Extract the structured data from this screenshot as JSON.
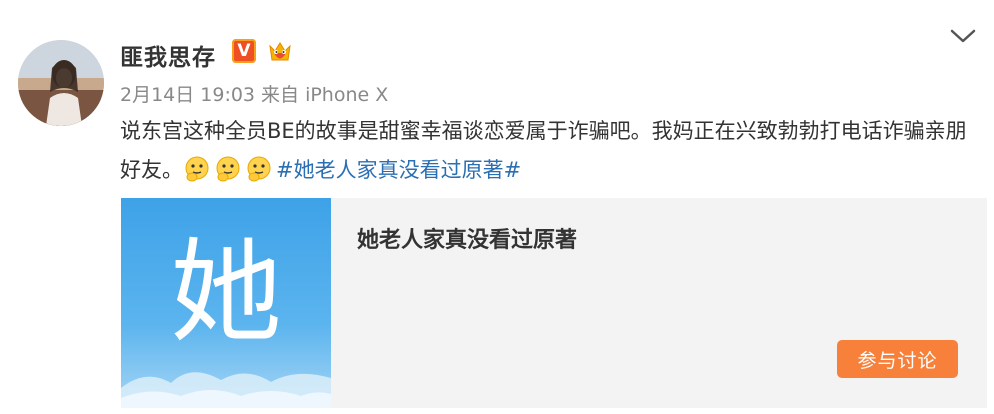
{
  "post": {
    "username": "匪我思存",
    "vip_badge_letter": "V",
    "date": "2月14日",
    "time": "19:03",
    "source": "来自 iPhone X",
    "text_main": "说东宫这种全员BE的故事是甜蜜幸福谈恋爱属于诈骗吧。我妈正在兴致勃勃打电话诈骗亲朋好友。",
    "emojis": [
      "hand-on-chin-emoji",
      "hand-on-chin-emoji",
      "hand-on-chin-emoji"
    ],
    "hashtag": "#她老人家真没看过原著#"
  },
  "card": {
    "thumb_char": "她",
    "title": "她老人家真没看过原著",
    "button_label": "参与讨论"
  },
  "colors": {
    "hashtag": "#2b6fb3",
    "button": "#f7813b",
    "vip": "#f04e23",
    "thumb": "#3ea2e8"
  },
  "icons": {
    "menu": "chevron-down-icon",
    "vip": "vip-v-badge-icon",
    "member": "crown-member-icon"
  }
}
